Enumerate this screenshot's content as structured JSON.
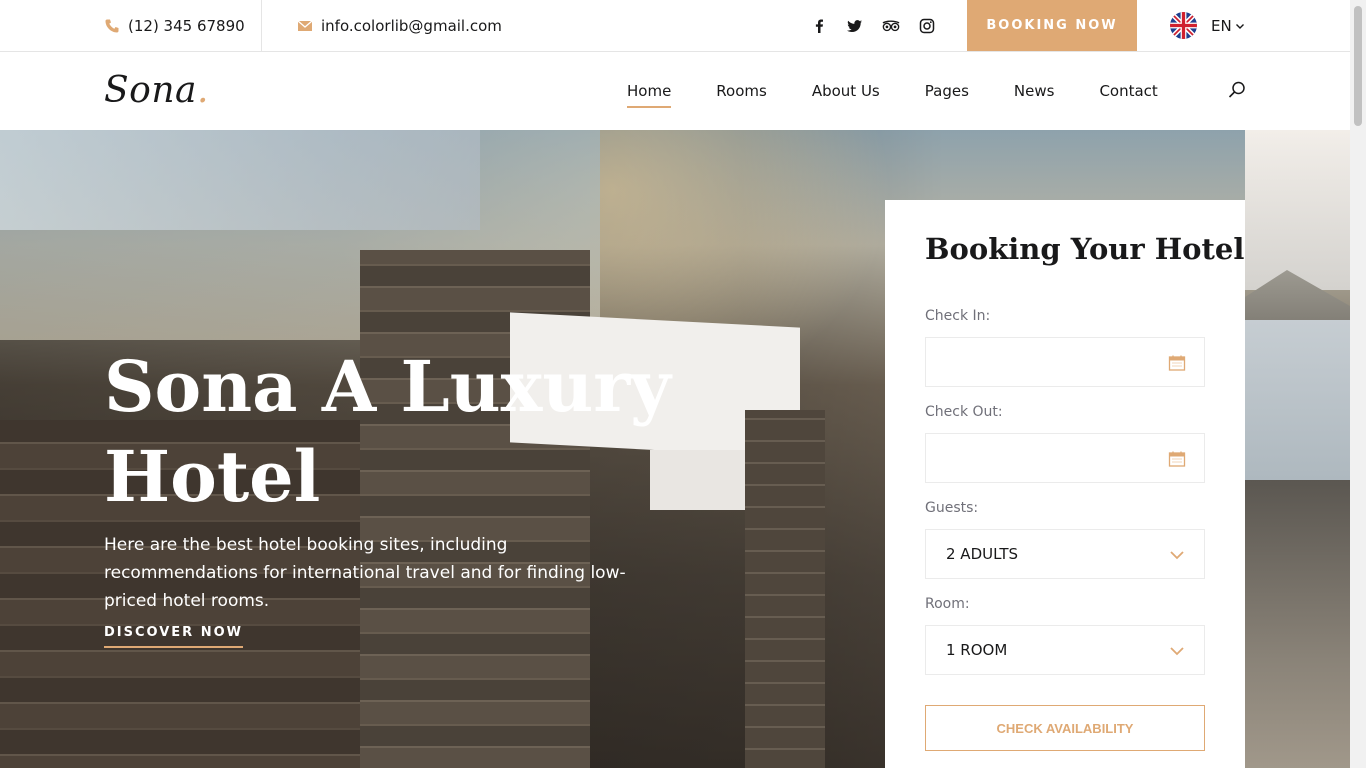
{
  "topbar": {
    "phone": "(12) 345 67890",
    "email": "info.colorlib@gmail.com",
    "socials": [
      "facebook-icon",
      "twitter-icon",
      "tripadvisor-icon",
      "instagram-icon"
    ],
    "booking_button": "Booking Now",
    "language": "EN"
  },
  "header": {
    "logo": "Sona",
    "logo_dot": ".",
    "nav": [
      {
        "label": "Home",
        "active": true
      },
      {
        "label": "Rooms",
        "active": false
      },
      {
        "label": "About Us",
        "active": false
      },
      {
        "label": "Pages",
        "active": false
      },
      {
        "label": "News",
        "active": false
      },
      {
        "label": "Contact",
        "active": false
      }
    ]
  },
  "hero": {
    "title_line1": "Sona A Luxury",
    "title_line2": "Hotel",
    "text": "Here are the best hotel booking sites, including recommendations for international travel and for finding low-priced hotel rooms.",
    "cta": "Discover Now"
  },
  "booking": {
    "title": "Booking Your Hotel",
    "check_in_label": "Check In:",
    "check_in_value": "",
    "check_out_label": "Check Out:",
    "check_out_value": "",
    "guests_label": "Guests:",
    "guests_value": "2 ADULTS",
    "room_label": "Room:",
    "room_value": "1 ROOM",
    "submit": "Check Availability"
  },
  "colors": {
    "accent": "#dfa974",
    "text": "#19191a",
    "muted": "#707079"
  }
}
